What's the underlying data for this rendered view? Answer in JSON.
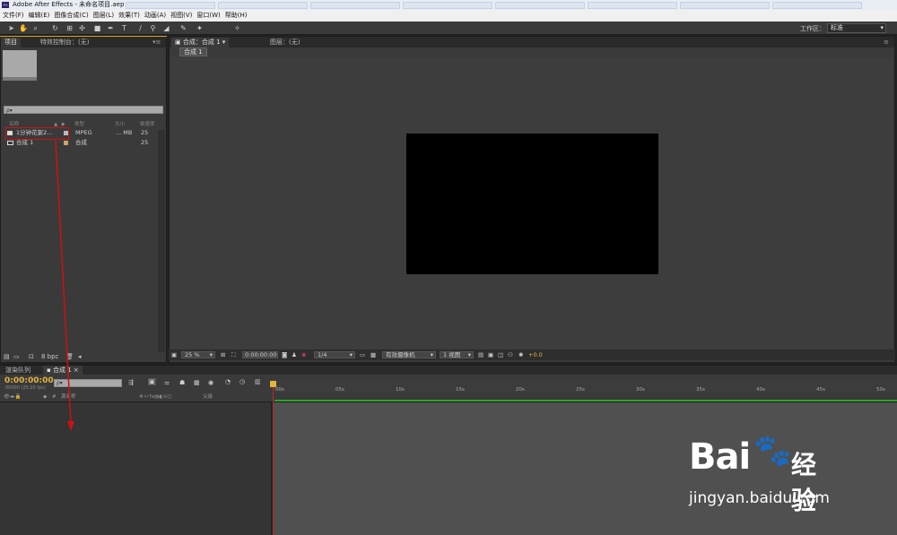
{
  "window": {
    "title": "Adobe After Effects - 未命名项目.aep *",
    "app_badge": "Ae"
  },
  "menu": [
    "文件(F)",
    "编辑(E)",
    "图像合成(C)",
    "图层(L)",
    "效果(T)",
    "动画(A)",
    "视图(V)",
    "窗口(W)",
    "帮助(H)"
  ],
  "toolbar": {
    "workspace_label": "工作区：",
    "workspace_value": "标准"
  },
  "project_panel": {
    "tabs": [
      "项目",
      "特效控制台：(无)"
    ],
    "search_placeholder": "ρ▾",
    "columns": [
      "名称",
      "类型",
      "大小",
      "帧速率"
    ],
    "items": [
      {
        "name": "1分钟花絮2...",
        "type": "MPEG",
        "size": "... MB",
        "fps": "25"
      },
      {
        "name": "合成 1",
        "type": "合成",
        "size": "",
        "fps": "25"
      }
    ],
    "footer_bpc": "8 bpc"
  },
  "comp_panel": {
    "tab": "合成：合成 1",
    "layer_tab": "图层：(无)",
    "flow_label": "合成 1",
    "zoom": "25 %",
    "timecode": "0:00:00:00",
    "resolution": "1/4",
    "camera": "有效摄像机",
    "views": "1 视图",
    "exposure": "+0.0"
  },
  "timeline": {
    "tabs": [
      "渲染队列",
      "合成 1"
    ],
    "timecode": "0:00:00:00",
    "fps_note": "00000 (25.00 fps)",
    "search_placeholder": "ρ▾",
    "col_source": "源名称",
    "col_parent": "父级",
    "ticks": [
      "00s",
      "05s",
      "10s",
      "15s",
      "20s",
      "25s",
      "30s",
      "35s",
      "40s",
      "45s",
      "50s"
    ]
  },
  "watermark": {
    "brand": "Bai",
    "brand2": "经验",
    "url": "jingyan.baidu.com"
  }
}
